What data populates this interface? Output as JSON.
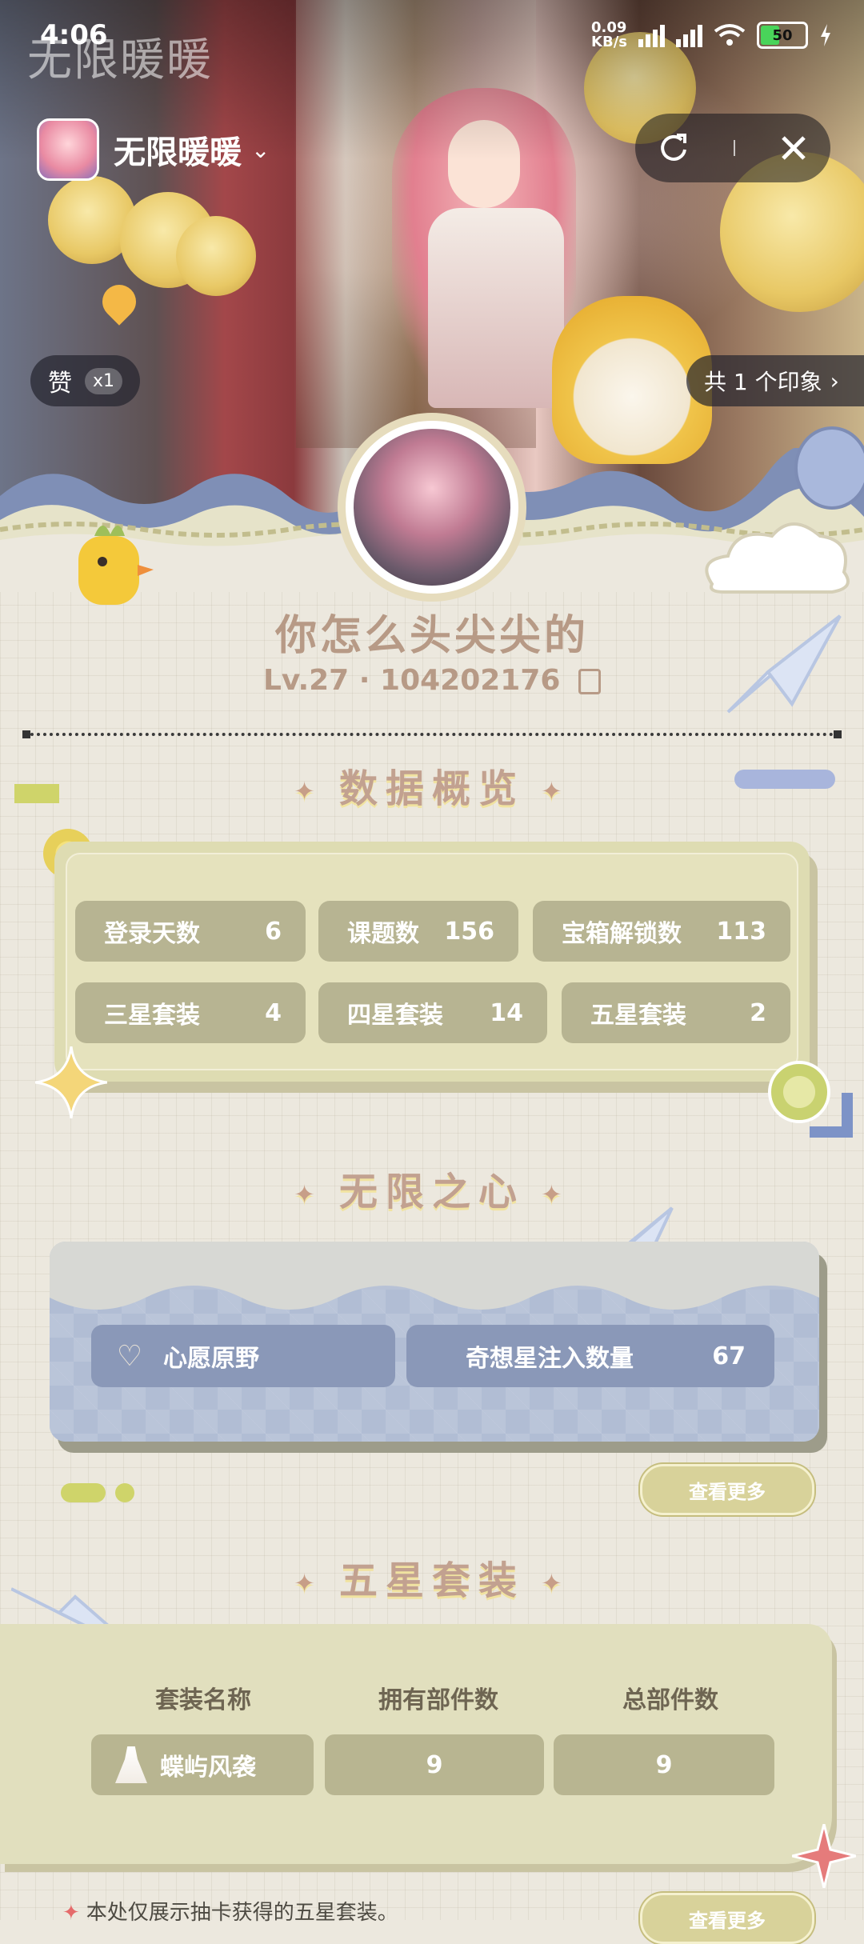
{
  "status_bar": {
    "time": "4:06",
    "net_speed_value": "0.09",
    "net_speed_unit": "KB/s",
    "battery": "50",
    "colors": {
      "battery_fill": "#49d45a"
    }
  },
  "watermark": "无限暖暖",
  "app": {
    "name": "无限暖暖",
    "icons": [
      "chevron-down-icon",
      "share-icon",
      "close-icon"
    ]
  },
  "hero": {
    "like_label": "赞",
    "like_count": "x1",
    "impression_label": "共 1 个印象",
    "impression_chevron": "›"
  },
  "profile": {
    "nickname": "你怎么头尖尖的",
    "level": "Lv.27",
    "separator": "·",
    "uid": "104202176"
  },
  "sections": {
    "overview_title": "数据概览",
    "heart_title": "无限之心",
    "suit_title": "五星套装"
  },
  "stats": [
    {
      "label": "登录天数",
      "value": "6"
    },
    {
      "label": "课题数",
      "value": "156"
    },
    {
      "label": "宝箱解锁数",
      "value": "113"
    },
    {
      "label": "三星套装",
      "value": "4"
    },
    {
      "label": "四星套装",
      "value": "14"
    },
    {
      "label": "五星套装",
      "value": "2"
    }
  ],
  "heart": {
    "region_label": "心愿原野",
    "inject_label": "奇想星注入数量",
    "inject_value": "67"
  },
  "more_button_label": "查看更多",
  "suit_table": {
    "headers": [
      "套装名称",
      "拥有部件数",
      "总部件数"
    ],
    "rows": [
      {
        "name": "蝶屿风袭",
        "owned": "9",
        "total": "9"
      }
    ]
  },
  "footnote": "本处仅展示抽卡获得的五星套装。",
  "colors": {
    "accent_text": "#b79a86",
    "stat_pill": "#b7b492",
    "heart_pill": "#8a98b8",
    "more_button": "#d8d29a"
  }
}
